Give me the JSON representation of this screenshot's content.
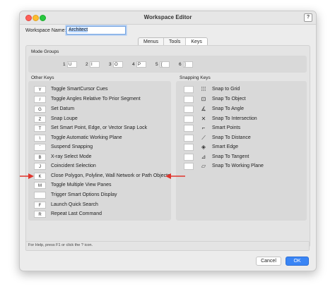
{
  "window": {
    "title": "Workspace Editor",
    "help_label": "?"
  },
  "workspace": {
    "name_label": "Workspace Name:",
    "name_value": "Architect"
  },
  "tabs": [
    {
      "label": "Menus"
    },
    {
      "label": "Tools"
    },
    {
      "label": "Keys"
    }
  ],
  "mode_groups": {
    "label": "Mode Groups",
    "items": [
      {
        "num": "1",
        "key": "U"
      },
      {
        "num": "2",
        "key": "I"
      },
      {
        "num": "3",
        "key": "O"
      },
      {
        "num": "4",
        "key": "P"
      },
      {
        "num": "5",
        "key": "["
      },
      {
        "num": "6",
        "key": "]"
      }
    ]
  },
  "other_keys": {
    "label": "Other Keys",
    "items": [
      {
        "key": "Y",
        "label": "Toggle SmartCursor Cues"
      },
      {
        "key": "/",
        "label": "Toggle Angles Relative To Prior Segment"
      },
      {
        "key": "G",
        "label": "Set Datum"
      },
      {
        "key": "Z",
        "label": "Snap Loupe"
      },
      {
        "key": "T",
        "label": "Set Smart Point, Edge, or Vector Snap Lock"
      },
      {
        "key": "\\",
        "label": "Toggle Automatic Working Plane"
      },
      {
        "key": "`",
        "label": "Suspend Snapping"
      },
      {
        "key": "B",
        "label": "X-ray Select Mode"
      },
      {
        "key": "J",
        "label": "Coincident Selection"
      },
      {
        "key": "K",
        "label": "Close Polygon, Polyline, Wall Network or Path Objects"
      },
      {
        "key": "M",
        "label": "Toggle Multiple View Panes"
      },
      {
        "key": "",
        "label": "Trigger Smart Options Display"
      },
      {
        "key": "F",
        "label": "Launch Quick Search"
      },
      {
        "key": "R",
        "label": "Repeat Last Command"
      }
    ]
  },
  "snapping_keys": {
    "label": "Snapping Keys",
    "items": [
      {
        "icon": "grid-icon",
        "glyph": "⁞⁞⁞",
        "label": "Snap to Grid"
      },
      {
        "icon": "object-icon",
        "glyph": "⊡",
        "label": "Snap To Object"
      },
      {
        "icon": "angle-icon",
        "glyph": "∡",
        "label": "Snap To Angle"
      },
      {
        "icon": "intersection-icon",
        "glyph": "✕",
        "label": "Snap To Intersection"
      },
      {
        "icon": "smart-points-icon",
        "glyph": "⌐",
        "label": "Smart Points"
      },
      {
        "icon": "distance-icon",
        "glyph": "⟋",
        "label": "Snap To Distance"
      },
      {
        "icon": "edge-icon",
        "glyph": "◈",
        "label": "Smart Edge"
      },
      {
        "icon": "tangent-icon",
        "glyph": "⊿",
        "label": "Snap To Tangent"
      },
      {
        "icon": "working-plane-icon",
        "glyph": "▱",
        "label": "Snap To Working Plane"
      }
    ]
  },
  "help_text": "For Help, press F1 or click the ? icon.",
  "buttons": {
    "cancel": "Cancel",
    "ok": "OK"
  },
  "colors": {
    "accent": "#3a85f5",
    "arrow": "#e0342c"
  }
}
